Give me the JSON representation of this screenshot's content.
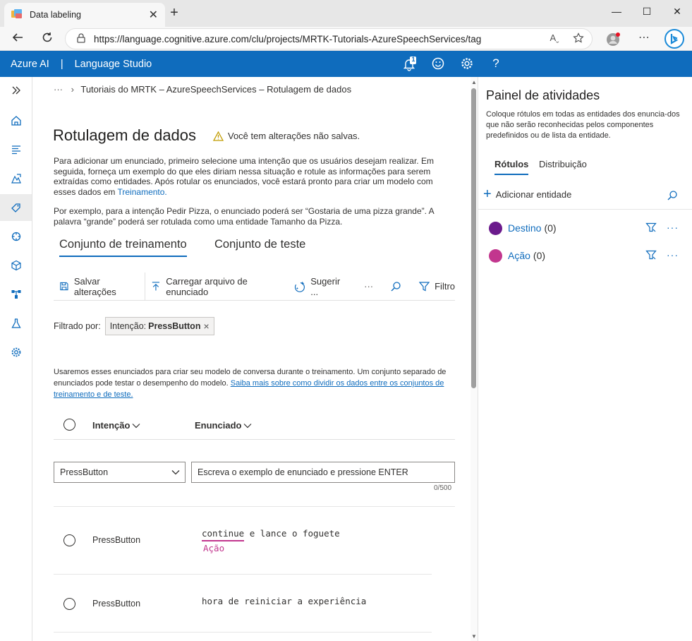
{
  "browser": {
    "tab_title": "Data labeling",
    "new_tab": "+",
    "url": "https://language.cognitive.azure.com/clu/projects/MRTK-Tutorials-AzureSpeechServices/tag",
    "read_aloud": "Aˬ",
    "more": "⋯"
  },
  "app_header": {
    "brand": "Azure AI",
    "separator": "|",
    "product": "Language Studio",
    "notification_count": "1"
  },
  "breadcrumb": {
    "ellipsis": "···",
    "path": "Tutoriais do MRTK – AzureSpeechServices – Rotulagem de dados"
  },
  "page": {
    "title": "Rotulagem de dados",
    "warning": "Você tem alterações não salvas.",
    "intro_text": "Para adicionar um enunciado, primeiro selecione uma intenção que os usuários desejam realizar. Em seguida, forneça um exemplo do que eles diriam nessa situação e rotule as informações para serem extraídas como entidades. Após rotular os enunciados, você estará pronto para criar um modelo com esses dados em ",
    "intro_link": "Treinamento.",
    "example_text": "Por exemplo, para a intenção Pedir Pizza, o enunciado poderá ser “Gostaria de uma pizza grande”. A palavra “grande” poderá ser rotulada como uma entidade Tamanho da Pizza.",
    "tabs": {
      "training": "Conjunto de treinamento",
      "test": "Conjunto de teste"
    }
  },
  "toolbar": {
    "save": "Salvar alterações",
    "upload": "Carregar arquivo de enunciado",
    "suggest": "Sugerir ...",
    "more": "···",
    "filter": "Filtro"
  },
  "filter": {
    "label": "Filtrado por:",
    "chip_key": "Intenção:",
    "chip_value": "PressButton",
    "chip_close": "×"
  },
  "info": {
    "text": "Usaremos esses enunciados para criar seu modelo de conversa durante o treinamento. Um conjunto separado de enunciados pode testar o desempenho do modelo. ",
    "link": "Saiba mais sobre como dividir os dados entre os conjuntos de treinamento e de teste."
  },
  "table": {
    "col_intent": "Intenção",
    "col_utterance": "Enunciado",
    "new_row": {
      "intent": "PressButton",
      "placeholder": "Escreva o exemplo de enunciado e pressione ENTER",
      "counter": "0/500"
    },
    "rows": [
      {
        "intent": "PressButton",
        "entity_word": "continue",
        "rest": " e lance o foguete",
        "entity_label": "Ação"
      },
      {
        "intent": "PressButton",
        "text": "hora de reiniciar a experiência"
      }
    ]
  },
  "panel": {
    "title": "Painel de atividades",
    "description": "Coloque rótulos em todas as entidades dos enuncia-dos que não serão reconhecidas pelos componentes predefinidos ou de lista da entidade.",
    "tabs": {
      "labels": "Rótulos",
      "distribution": "Distribuição"
    },
    "add_entity": "Adicionar entidade",
    "entities": [
      {
        "name": "Destino",
        "count": "(0)",
        "color": "#6b1a8c"
      },
      {
        "name": "Ação",
        "count": "(0)",
        "color": "#c2368e"
      }
    ],
    "more": "···"
  },
  "colors": {
    "accent": "#0f6cbd",
    "header": "#0f6cbd",
    "entity_action": "#c2368e",
    "entity_destination": "#6b1a8c"
  }
}
